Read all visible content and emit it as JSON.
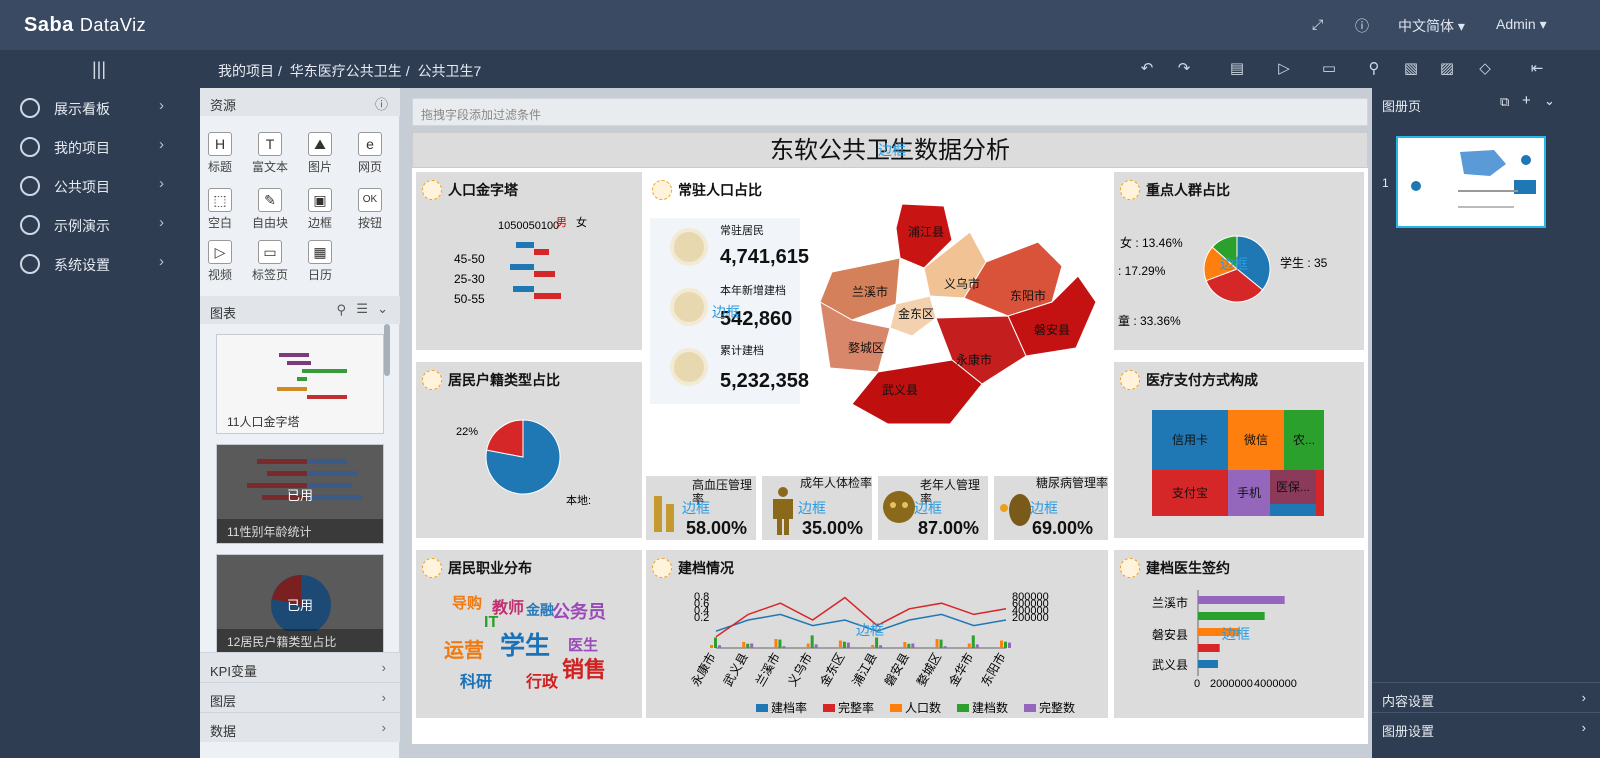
{
  "app": {
    "logo_main": "Saba",
    "logo_sub": "DataViz",
    "language": "中文简体 ▾",
    "user": "Admin ▾"
  },
  "breadcrumb": [
    "我的项目",
    "华东医疗公共卫生",
    "公共卫生7"
  ],
  "sidebar": {
    "items": [
      {
        "label": "展示看板"
      },
      {
        "label": "我的项目"
      },
      {
        "label": "公共项目"
      },
      {
        "label": "示例演示"
      },
      {
        "label": "系统设置"
      }
    ]
  },
  "resources": {
    "title": "资源",
    "tools": [
      {
        "label": "标题",
        "glyph": "H"
      },
      {
        "label": "富文本",
        "glyph": "T"
      },
      {
        "label": "图片",
        "glyph": "⛰"
      },
      {
        "label": "网页",
        "glyph": "e"
      },
      {
        "label": "空白",
        "glyph": "⬚"
      },
      {
        "label": "自由块",
        "glyph": "✎"
      },
      {
        "label": "边框",
        "glyph": "▣"
      },
      {
        "label": "按钮",
        "glyph": "OK"
      },
      {
        "label": "视频",
        "glyph": "▷"
      },
      {
        "label": "标签页",
        "glyph": "▭"
      },
      {
        "label": "日历",
        "glyph": "▦"
      }
    ],
    "charts_title": "图表",
    "thumbs": [
      {
        "caption": "11人口金字塔",
        "used": ""
      },
      {
        "caption": "11性别年龄统计",
        "used": "已用"
      },
      {
        "caption": "12居民户籍类型占比",
        "used": "已用"
      }
    ],
    "accordions": [
      "KPI变量",
      "图层",
      "数据"
    ]
  },
  "canvas": {
    "filter_placeholder": "拖拽字段添加过滤条件",
    "title": "东软公共卫生数据分析",
    "border_label": "边框"
  },
  "cards": {
    "pyramid": {
      "title": "人口金字塔",
      "axis": "1050050100",
      "rows": [
        "45-50",
        "25-30",
        "50-55"
      ],
      "legend": [
        "男",
        "女"
      ]
    },
    "resident": {
      "title": "常驻人口占比",
      "kpis": [
        {
          "label": "常驻居民",
          "value": "4,741,615"
        },
        {
          "label": "本年新增建档",
          "value": "542,860"
        },
        {
          "label": "累计建档",
          "value": "5,232,358"
        }
      ],
      "regions": [
        "浦江县",
        "兰溪市",
        "义乌市",
        "东阳市",
        "金东区",
        "婺城区",
        "磐安县",
        "永康市",
        "武义县"
      ]
    },
    "key_population": {
      "title": "重点人群占比",
      "labels": [
        "女 : 13.46%",
        ": 17.29%",
        "童 : 33.36%",
        "学生 : 35"
      ]
    },
    "household": {
      "title": "居民户籍类型占比",
      "labels": [
        "22%",
        "本地:"
      ]
    },
    "payment": {
      "title": "医疗支付方式构成",
      "cells": [
        "信用卡",
        "微信",
        "农...",
        "支付宝",
        "手机",
        "医保..."
      ]
    },
    "rates": [
      {
        "label": "高血压管理率",
        "value": "58.00%"
      },
      {
        "label": "成年人体检率",
        "value": "35.00%"
      },
      {
        "label": "老年人管理率",
        "value": "87.00%"
      },
      {
        "label": "糖尿病管理率",
        "value": "69.00%"
      }
    ],
    "occupation": {
      "title": "居民职业分布",
      "words": [
        "导购",
        "教师",
        "金融",
        "公务员",
        "IT",
        "运营",
        "学生",
        "医生",
        "销售",
        "科研",
        "行政"
      ]
    },
    "filing": {
      "title": "建档情况",
      "left_ticks": [
        "0.8",
        "0.6",
        "0.4",
        "0.2"
      ],
      "right_ticks": [
        "800000",
        "600000",
        "400000",
        "200000"
      ],
      "categories": [
        "永康市",
        "武义县",
        "兰溪市",
        "义乌市",
        "金东区",
        "浦江县",
        "磐安县",
        "婺城区",
        "金华市",
        "东阳市"
      ],
      "legend": [
        "建档率",
        "完整率",
        "人口数",
        "建档数",
        "完整数"
      ]
    },
    "doctor": {
      "title": "建档医生签约",
      "labels": [
        "兰溪市",
        "磐安县",
        "武义县"
      ],
      "ticks": [
        "0",
        "2000000",
        "4000000"
      ]
    }
  },
  "right_panel": {
    "title": "图册页",
    "page_no": "1",
    "accordions": [
      "内容设置",
      "图册设置"
    ]
  },
  "chart_data": [
    {
      "type": "bar",
      "title": "人口金字塔",
      "categories": [
        "45-50",
        "25-30",
        "50-55"
      ],
      "series": [
        {
          "name": "男",
          "values": [
            -60,
            -80,
            -70
          ]
        },
        {
          "name": "女",
          "values": [
            50,
            70,
            90
          ]
        }
      ]
    },
    {
      "type": "pie",
      "title": "重点人群占比",
      "categories": [
        "学生",
        "童",
        "",
        "女"
      ],
      "values": [
        35.89,
        33.36,
        17.29,
        13.46
      ]
    },
    {
      "type": "pie",
      "title": "居民户籍类型占比",
      "categories": [
        "本地",
        ""
      ],
      "values": [
        78,
        22
      ]
    },
    {
      "type": "bar",
      "title": "建档医生签约",
      "categories": [
        "兰溪市",
        "",
        "磐安县",
        "",
        "武义县"
      ],
      "values": [
        5200000,
        4000000,
        2500000,
        1300000,
        1200000
      ],
      "xlim": [
        0,
        6000000
      ]
    },
    {
      "type": "line",
      "title": "建档情况",
      "categories": [
        "永康市",
        "武义县",
        "兰溪市",
        "义乌市",
        "金东区",
        "浦江县",
        "磐安县",
        "婺城区",
        "金华市",
        "东阳市"
      ],
      "series": [
        {
          "name": "建档率",
          "values": [
            0.3,
            0.5,
            0.6,
            0.4,
            0.5,
            0.3,
            0.5,
            0.6,
            0.4,
            0.5
          ]
        },
        {
          "name": "完整率",
          "values": [
            0.2,
            0.6,
            0.8,
            0.5,
            0.9,
            0.4,
            0.7,
            0.8,
            0.6,
            0.7
          ]
        }
      ]
    }
  ]
}
